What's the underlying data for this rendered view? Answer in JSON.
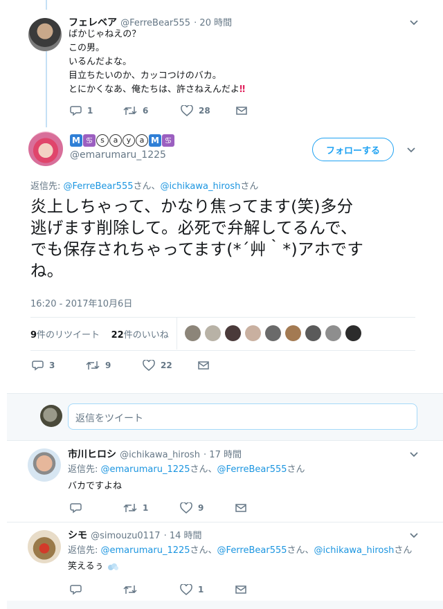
{
  "tweet1": {
    "name": "フェレベア",
    "handle": "@FerreBear555",
    "time": "· 20 時間",
    "lines": [
      "ばかじゃねえの？",
      "この男。",
      "いるんだよな。",
      "目立ちたいのか、カッコつけのバカ。",
      "とにかくなあ、俺たちは、許さねえんだよ"
    ],
    "emphasis": "‼",
    "reply_count": "1",
    "retweet_count": "6",
    "like_count": "28"
  },
  "main_tweet": {
    "name_badges": [
      "M",
      "♋",
      "s",
      "a",
      "y",
      "a",
      "M",
      "♋"
    ],
    "handle": "@emarumaru_1225",
    "follow_label": "フォローする",
    "reply_to_prefix": "返信先: ",
    "reply_to_1": "@FerreBear555",
    "reply_to_sep": "さん、",
    "reply_to_2": "@ichikawa_hirosh",
    "reply_to_suffix": "さん",
    "text_lines": [
      "炎上しちゃって、かなり焦ってます(笑)多分",
      "逃げます削除して。必死で弁解してるんで、",
      "でも保存されちゃってます(*´艸｀*)アホです",
      "ね。"
    ],
    "timestamp": "16:20 - 2017年10月6日",
    "retweets_num": "9",
    "retweets_label": "件のリツイート",
    "likes_num": "22",
    "likes_label": "件のいいね",
    "reply_count": "3",
    "retweet_count": "9",
    "like_count": "22"
  },
  "reply_box": {
    "placeholder": "返信をツイート"
  },
  "reply1": {
    "name": "市川ヒロシ",
    "handle": "@ichikawa_hirosh",
    "time": "· 17 時間",
    "reply_to_prefix": "返信先: ",
    "reply_to_1": "@emarumaru_1225",
    "reply_to_sep": "さん、",
    "reply_to_2": "@FerreBear555",
    "reply_to_suffix": "さん",
    "text": "バカですよね",
    "reply_count": "",
    "retweet_count": "1",
    "like_count": "9"
  },
  "reply2": {
    "name": "シモ",
    "handle": "@simouzu0117",
    "time": "· 14 時間",
    "reply_to_prefix": "返信先: ",
    "reply_to_1": "@emarumaru_1225",
    "reply_to_sep": "さん、",
    "reply_to_2": "@FerreBear555",
    "reply_to_sep2": "さん、",
    "reply_to_3": "@ichikawa_hirosh",
    "reply_to_suffix": "さん",
    "text": "笑えるぅ",
    "reply_count": "",
    "retweet_count": "",
    "like_count": "1"
  },
  "colors": {
    "link": "#1b95e0",
    "muted": "#657786",
    "accent": "#1da1f2",
    "emphasis_red": "#e0245e"
  },
  "icons": [
    "caret-down-icon",
    "reply-icon",
    "retweet-icon",
    "like-icon",
    "dm-icon"
  ]
}
